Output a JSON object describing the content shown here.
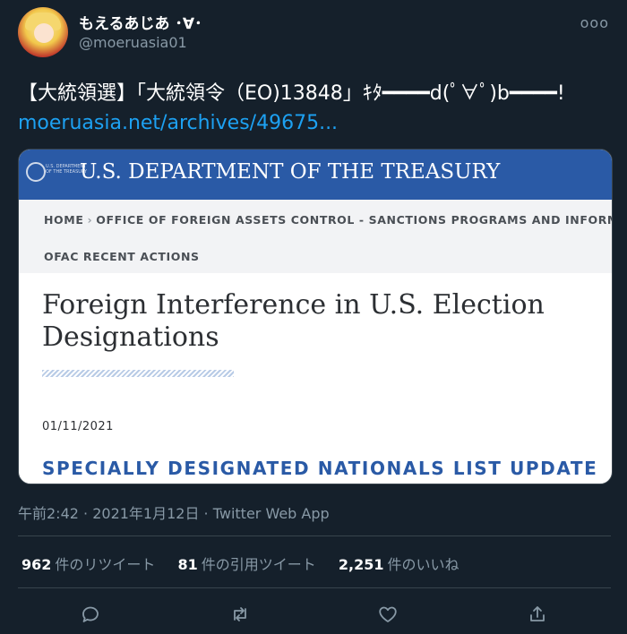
{
  "user": {
    "display_name": "もえるあじあ ･∀･",
    "handle": "@moeruasia01",
    "more_icon": "more-horizontal-icon",
    "more_label": "ooo"
  },
  "tweet": {
    "text": "【大統領選】「大統領令（EO)13848」ｷﾀ━━━━d(ﾟ∀ﾟ)b━━━━! ",
    "link": "moeruasia.net/archives/49675..."
  },
  "card": {
    "seal_text": "U.S. DEPARTMENT OF THE TREASURY",
    "banner_title": "U.S. DEPARTMENT OF THE TREASURY",
    "breadcrumb": [
      "HOME",
      "OFFICE OF FOREIGN ASSETS CONTROL - SANCTIONS PROGRAMS AND INFORMATION",
      "OFAC RECENT ACTIONS"
    ],
    "breadcrumb_sep": "›",
    "heading": "Foreign Interference in U.S. Election Designations",
    "date": "01/11/2021",
    "subheading": "SPECIALLY DESIGNATED NATIONALS LIST UPDATE"
  },
  "meta": {
    "time": "午前2:42",
    "date": "2021年1月12日",
    "source": "Twitter Web App",
    "sep": " · "
  },
  "stats": [
    {
      "count": "962",
      "label": "件のリツイート"
    },
    {
      "count": "81",
      "label": "件の引用ツイート"
    },
    {
      "count": "2,251",
      "label": "件のいいね"
    }
  ],
  "actions": [
    "reply-icon",
    "retweet-icon",
    "like-icon",
    "share-icon"
  ],
  "colors": {
    "background": "#15202b",
    "link": "#1da1f2",
    "muted": "#8899a6",
    "treasury_blue": "#2a5aa6"
  }
}
